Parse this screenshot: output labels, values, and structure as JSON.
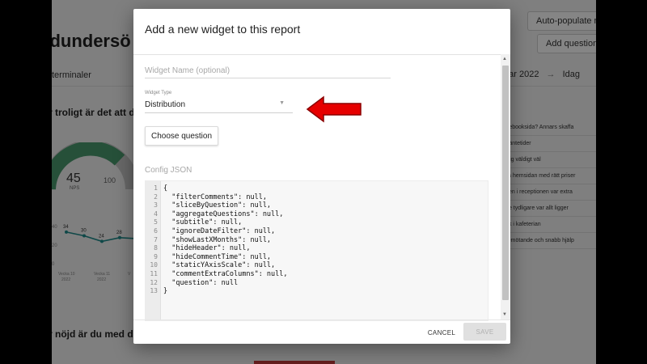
{
  "background": {
    "page_title": "ndundersö",
    "filter_text": "terminaler",
    "auto_populate_label": "Auto-populate re",
    "add_question_label": "Add question f",
    "date_from": "mar 2022",
    "date_arrow": "→",
    "date_to": "Idag",
    "section_question_1": "r troligt är det att du",
    "section_question_2": "r nöjd är du med ditt",
    "nps": {
      "value": "45",
      "label": "NPS",
      "max_label": "100"
    },
    "comments": [
      "facebooksida? Annars skaffa",
      "e väntetider",
      "r mig väldigt väl",
      "tera hemsidan med rätt priser",
      "salen i receptionen var extra",
      "t lite tydligare var allt ligger",
      "disk i kafeterian",
      "t bemötande och snabb hjälp"
    ],
    "trend_chart": {
      "type": "line",
      "y_axis_labels": [
        "40",
        "20",
        "0"
      ],
      "points": [
        {
          "label": "34",
          "value": 34
        },
        {
          "label": "30",
          "value": 30
        },
        {
          "label": "24",
          "value": 24
        },
        {
          "label": "28",
          "value": 28
        },
        {
          "label": "",
          "value": 27
        }
      ],
      "x_labels": [
        {
          "week": "Vecka 10",
          "year": "2022"
        },
        {
          "week": "Vecka 11",
          "year": "2022"
        },
        {
          "week": "V",
          "year": ""
        }
      ],
      "line_color": "#1e8a8a"
    },
    "gauge_colors": {
      "fill": "#4a9a6e",
      "track": "#c8c8c8"
    }
  },
  "dialog": {
    "title": "Add a new widget to this report",
    "widget_name": {
      "placeholder": "Widget Name (optional)",
      "value": ""
    },
    "widget_type": {
      "label": "Widget Type",
      "value": "Distribution"
    },
    "choose_question_label": "Choose question",
    "config_json_label": "Config JSON",
    "config_lines": [
      "{",
      "  \"filterComments\": null,",
      "  \"sliceByQuestion\": null,",
      "  \"aggregateQuestions\": null,",
      "  \"subtitle\": null,",
      "  \"ignoreDateFilter\": null,",
      "  \"showLastXMonths\": null,",
      "  \"hideHeader\": null,",
      "  \"hideCommentTime\": null,",
      "  \"staticYAxisScale\": null,",
      "  \"commentExtraColumns\": null,",
      "  \"question\": null",
      "}"
    ],
    "cancel_label": "CANCEL",
    "save_label": "SAVE"
  },
  "annotation": {
    "icon": "red-arrow-icon",
    "color": "#e60000"
  }
}
